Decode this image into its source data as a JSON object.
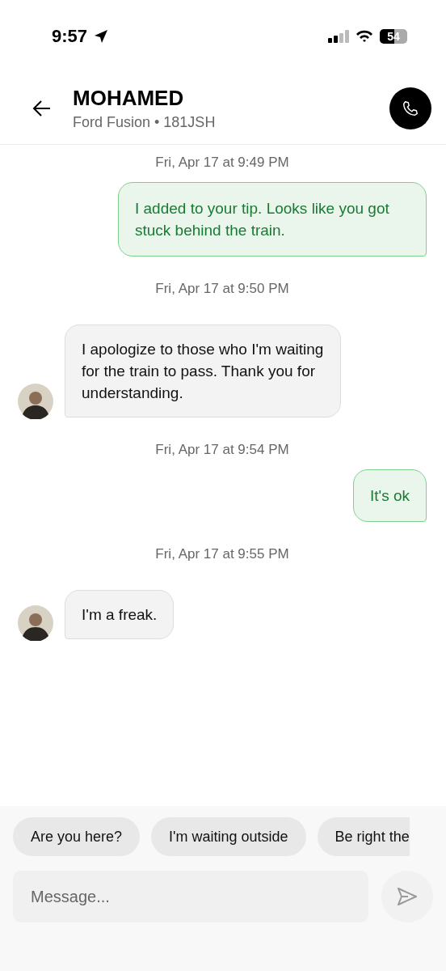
{
  "status_bar": {
    "time": "9:57",
    "battery": "54"
  },
  "header": {
    "name": "MOHAMED",
    "vehicle": "Ford Fusion • 181JSH"
  },
  "messages": [
    {
      "kind": "timestamp",
      "text": "Fri, Apr 17 at 9:49 PM"
    },
    {
      "kind": "outgoing",
      "text": "I added to your tip. Looks like you got stuck behind the train."
    },
    {
      "kind": "timestamp",
      "text": "Fri, Apr 17 at 9:50 PM"
    },
    {
      "kind": "incoming",
      "text": "I apologize to those who I'm waiting for the train to pass. Thank you for understanding."
    },
    {
      "kind": "timestamp",
      "text": "Fri, Apr 17 at 9:54 PM"
    },
    {
      "kind": "outgoing",
      "text": "It's ok"
    },
    {
      "kind": "timestamp",
      "text": "Fri, Apr 17 at 9:55 PM"
    },
    {
      "kind": "incoming",
      "text": "I'm a freak."
    }
  ],
  "quick_replies": [
    "Are you here?",
    "I'm waiting outside",
    "Be right the"
  ],
  "composer": {
    "placeholder": "Message..."
  }
}
